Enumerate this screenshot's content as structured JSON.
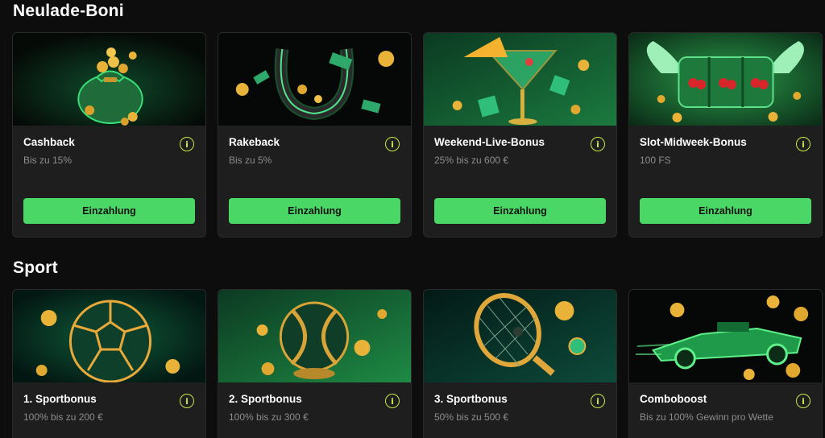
{
  "sections": [
    {
      "title": "Neulade-Boni",
      "cards": [
        {
          "title": "Cashback",
          "subtitle": "Bis zu 15%",
          "button": "Einzahlung",
          "image": "money-bag-icon"
        },
        {
          "title": "Rakeback",
          "subtitle": "Bis zu 5%",
          "button": "Einzahlung",
          "image": "horseshoe-icon"
        },
        {
          "title": "Weekend-Live-Bonus",
          "subtitle": "25% bis zu 600 €",
          "button": "Einzahlung",
          "image": "cocktail-dice-icon"
        },
        {
          "title": "Slot-Midweek-Bonus",
          "subtitle": "100 FS",
          "button": "Einzahlung",
          "image": "slot-reel-icon"
        }
      ]
    },
    {
      "title": "Sport",
      "cards": [
        {
          "title": "1. Sportbonus",
          "subtitle": "100% bis zu 200 €",
          "image": "soccer-ball-icon"
        },
        {
          "title": "2. Sportbonus",
          "subtitle": "100% bis zu 300 €",
          "image": "tennis-ball-icon"
        },
        {
          "title": "3. Sportbonus",
          "subtitle": "50% bis zu 500 €",
          "image": "tennis-racket-icon"
        },
        {
          "title": "Comboboost",
          "subtitle": "Bis zu 100% Gewinn pro Wette",
          "image": "race-car-icon"
        }
      ]
    }
  ],
  "colors": {
    "background": "#0d0d0d",
    "card": "#1e1e1e",
    "accent_green": "#4bd765",
    "info_icon": "#c6e84a",
    "subtitle": "#8d8d8d"
  }
}
